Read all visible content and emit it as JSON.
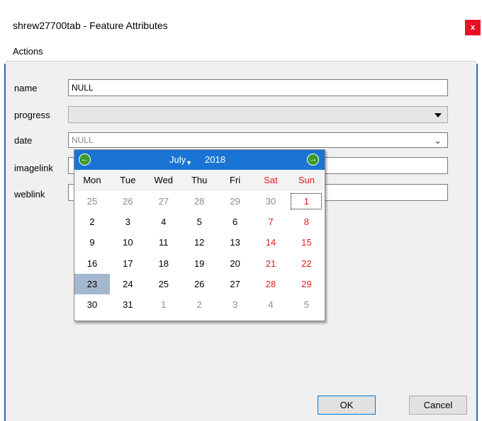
{
  "window": {
    "title": "shrew27700tab - Feature Attributes",
    "close_label": "x"
  },
  "menu": {
    "actions": "Actions"
  },
  "form": {
    "name_label": "name",
    "name_value": "NULL",
    "progress_label": "progress",
    "progress_value": "",
    "date_label": "date",
    "date_value": "NULL",
    "imagelink_label": "imagelink",
    "weblink_label": "weblink"
  },
  "calendar": {
    "month": "July",
    "year": "2018",
    "prev_icon": "←",
    "next_icon": "→",
    "days_of_week": [
      "Mon",
      "Tue",
      "Wed",
      "Thu",
      "Fri",
      "Sat",
      "Sun"
    ],
    "weeks": [
      [
        "25",
        "26",
        "27",
        "28",
        "29",
        "30",
        "1"
      ],
      [
        "2",
        "3",
        "4",
        "5",
        "6",
        "7",
        "8"
      ],
      [
        "9",
        "10",
        "11",
        "12",
        "13",
        "14",
        "15"
      ],
      [
        "16",
        "17",
        "18",
        "19",
        "20",
        "21",
        "22"
      ],
      [
        "23",
        "24",
        "25",
        "26",
        "27",
        "28",
        "29"
      ],
      [
        "30",
        "31",
        "1",
        "2",
        "3",
        "4",
        "5"
      ]
    ],
    "selected_day": "23",
    "today_day": "1",
    "colors": {
      "header": "#1a74d4",
      "weekend": "#e81919",
      "selected": "#a3b7cd",
      "nav": "#3c9a2c"
    }
  },
  "buttons": {
    "ok": "OK",
    "cancel": "Cancel"
  }
}
